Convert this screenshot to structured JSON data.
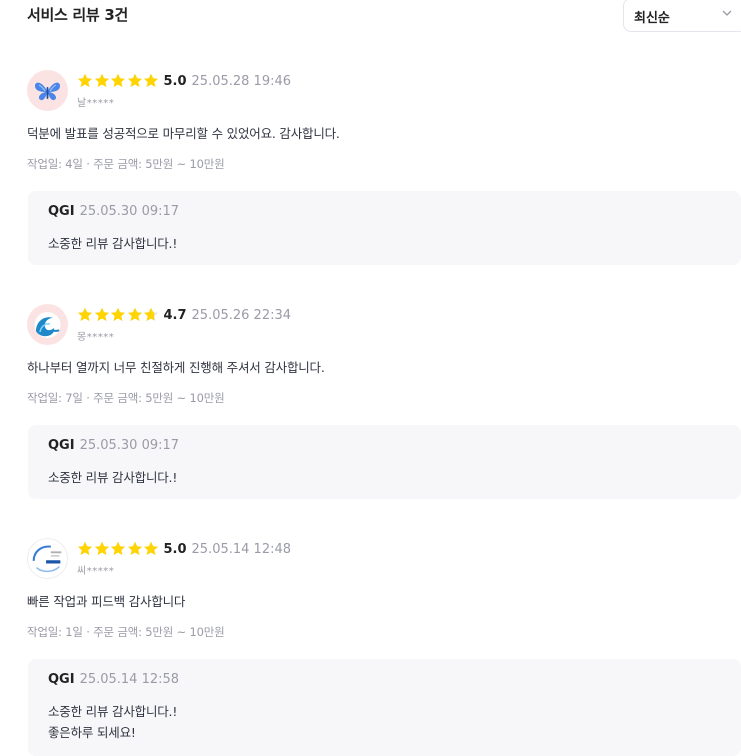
{
  "header": {
    "title": "서비스 리뷰 3건",
    "sort_selected": "최신순"
  },
  "colors": {
    "star": "#ffd400",
    "muted_text": "#9a9ba7",
    "reply_background": "#f7f7f9"
  },
  "reviews": [
    {
      "avatar_icon": "butterfly-icon",
      "rating": 5.0,
      "score": "5.0",
      "date": "25.05.28 19:46",
      "nickname": "날*****",
      "text": "덕분에 발표를 성공적으로 마무리할 수 있었어요. 감사합니다.",
      "meta": "작업일: 4일 · 주문 금액: 5만원 ~ 10만원",
      "reply": {
        "author": "QGI",
        "date": "25.05.30 09:17",
        "text": "소중한 리뷰 감사합니다.!"
      }
    },
    {
      "avatar_icon": "wave-icon",
      "rating": 4.7,
      "score": "4.7",
      "date": "25.05.26 22:34",
      "nickname": "몽*****",
      "text": "하나부터 열까지 너무 친절하게 진행해 주셔서 감사합니다.",
      "meta": "작업일: 7일 · 주문 금액: 5만원 ~ 10만원",
      "reply": {
        "author": "QGI",
        "date": "25.05.30 09:17",
        "text": "소중한 리뷰 감사합니다.!"
      }
    },
    {
      "avatar_icon": "company-logo-icon",
      "rating": 5.0,
      "score": "5.0",
      "date": "25.05.14 12:48",
      "nickname": "씨*****",
      "text": "빠른 작업과 피드백 감사합니다",
      "meta": "작업일: 1일 · 주문 금액: 5만원 ~ 10만원",
      "reply": {
        "author": "QGI",
        "date": "25.05.14 12:58",
        "text": "소중한 리뷰 감사합니다.!\n좋은하루 되세요!"
      }
    }
  ]
}
